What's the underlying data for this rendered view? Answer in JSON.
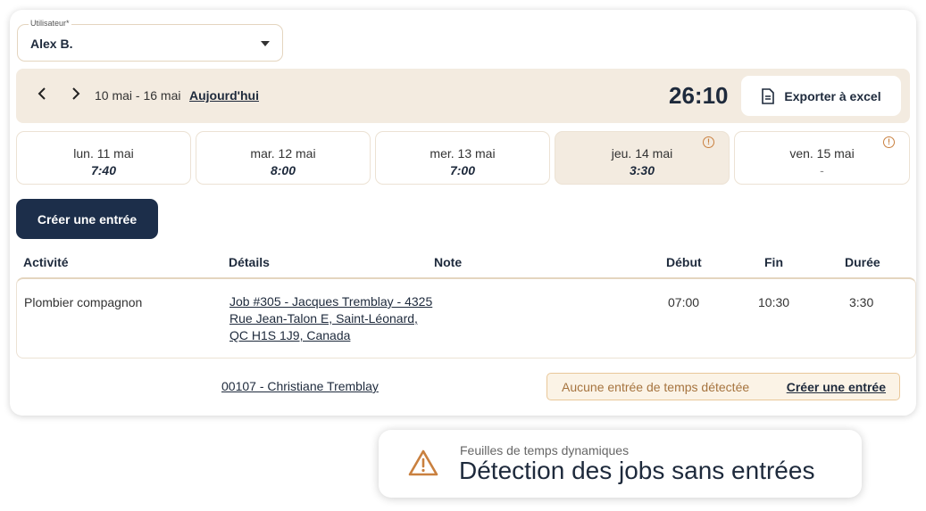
{
  "user": {
    "label": "Utilisateur*",
    "value": "Alex B."
  },
  "week": {
    "range": "10 mai - 16 mai",
    "today_label": "Aujourd'hui",
    "total": "26:10",
    "export_label": "Exporter à excel"
  },
  "days": [
    {
      "label": "lun. 11 mai",
      "hours": "7:40",
      "warning": false
    },
    {
      "label": "mar. 12 mai",
      "hours": "8:00",
      "warning": false
    },
    {
      "label": "mer. 13 mai",
      "hours": "7:00",
      "warning": false
    },
    {
      "label": "jeu. 14 mai",
      "hours": "3:30",
      "warning": true
    },
    {
      "label": "ven. 15 mai",
      "hours": "-",
      "warning": true
    }
  ],
  "create_label": "Créer une entrée",
  "table": {
    "headers": {
      "activity": "Activité",
      "details": "Détails",
      "note": "Note",
      "start": "Début",
      "end": "Fin",
      "duration": "Durée"
    },
    "rows": [
      {
        "activity": "Plombier compagnon",
        "details_line1": "Job #305 - Jacques Tremblay - 4325",
        "details_line2": "Rue Jean-Talon E, Saint-Léonard,",
        "details_line3": "QC H1S 1J9, Canada",
        "note": "",
        "start": "07:00",
        "end": "10:30",
        "duration": "3:30"
      }
    ]
  },
  "missing_job": {
    "job": "00107 - Christiane Tremblay",
    "message": "Aucune entrée de temps détectée",
    "action": "Créer une entrée"
  },
  "toast": {
    "subtitle": "Feuilles de temps dynamiques",
    "title": "Détection des jobs sans entrées"
  },
  "colors": {
    "accent": "#1c2e4a",
    "warning": "#c9803f",
    "panel": "#f3ebe0"
  }
}
